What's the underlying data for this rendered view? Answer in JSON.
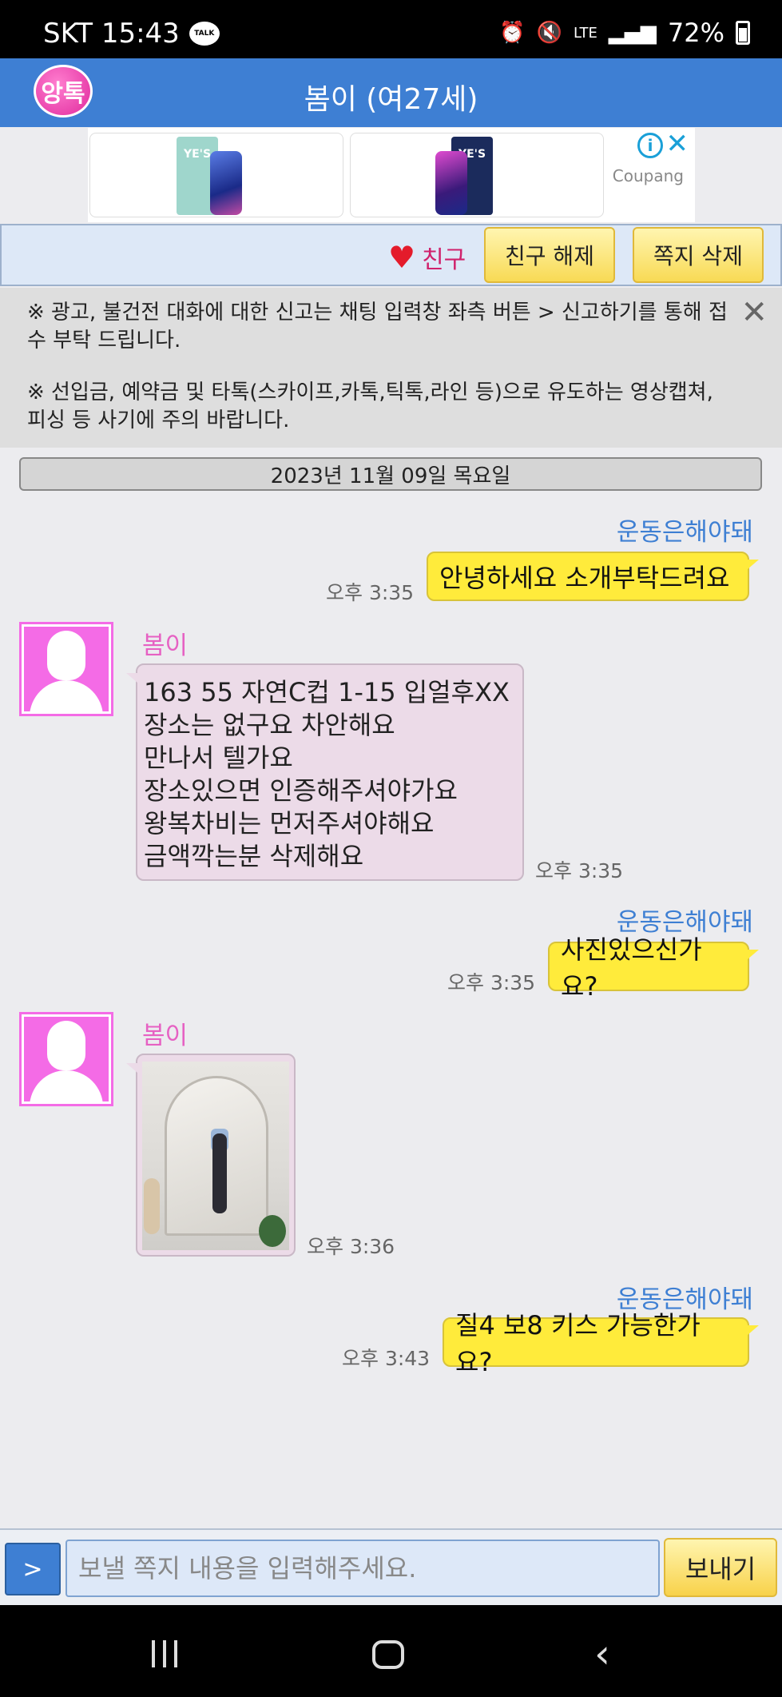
{
  "status_bar": {
    "carrier_time": "SKT 15:43",
    "talk_badge": "TALK",
    "lte": "LTE",
    "battery": "72%"
  },
  "header": {
    "logo": "앙톡",
    "title": "봄이 (여27세)"
  },
  "ad": {
    "brand": "Coupang",
    "box_text": "YE'S"
  },
  "friend_bar": {
    "status": "친구",
    "unfriend_button": "친구 해제",
    "delete_button": "쪽지 삭제"
  },
  "notice": {
    "line1": "※ 광고, 불건전 대화에 대한 신고는 채팅 입력창 좌측 버튼 > 신고하기를 통해 접수 부탁 드립니다.",
    "line2": "※ 선입금, 예약금 및 타톡(스카이프,카톡,틱톡,라인 등)으로 유도하는 영상캡쳐,피싱 등 사기에 주의 바랍니다."
  },
  "chat": {
    "date": "2023년 11월 09일 목요일",
    "my_name": "운동은해야돼",
    "partner_name": "봄이",
    "messages": [
      {
        "from": "me",
        "text": "안녕하세요 소개부탁드려요",
        "time": "오후 3:35"
      },
      {
        "from": "them",
        "lines": [
          "163 55 자연C컵 1-15 입얼후XX",
          "장소는 없구요 차안해요",
          "만나서 텔가요",
          "장소있으면 인증해주셔야가요",
          "왕복차비는 먼저주셔야해요",
          "금액깍는분 삭제해요"
        ],
        "time": "오후 3:35"
      },
      {
        "from": "me",
        "text": "사진있으신가요?",
        "time": "오후 3:35"
      },
      {
        "from": "them",
        "type": "photo",
        "time": "오후 3:36"
      },
      {
        "from": "me",
        "text": "질4 보8 키스 가능한가요?",
        "time": "오후 3:43"
      }
    ]
  },
  "composer": {
    "menu_button": ">",
    "placeholder": "보낼 쪽지 내용을 입력해주세요.",
    "send_button": "보내기"
  }
}
